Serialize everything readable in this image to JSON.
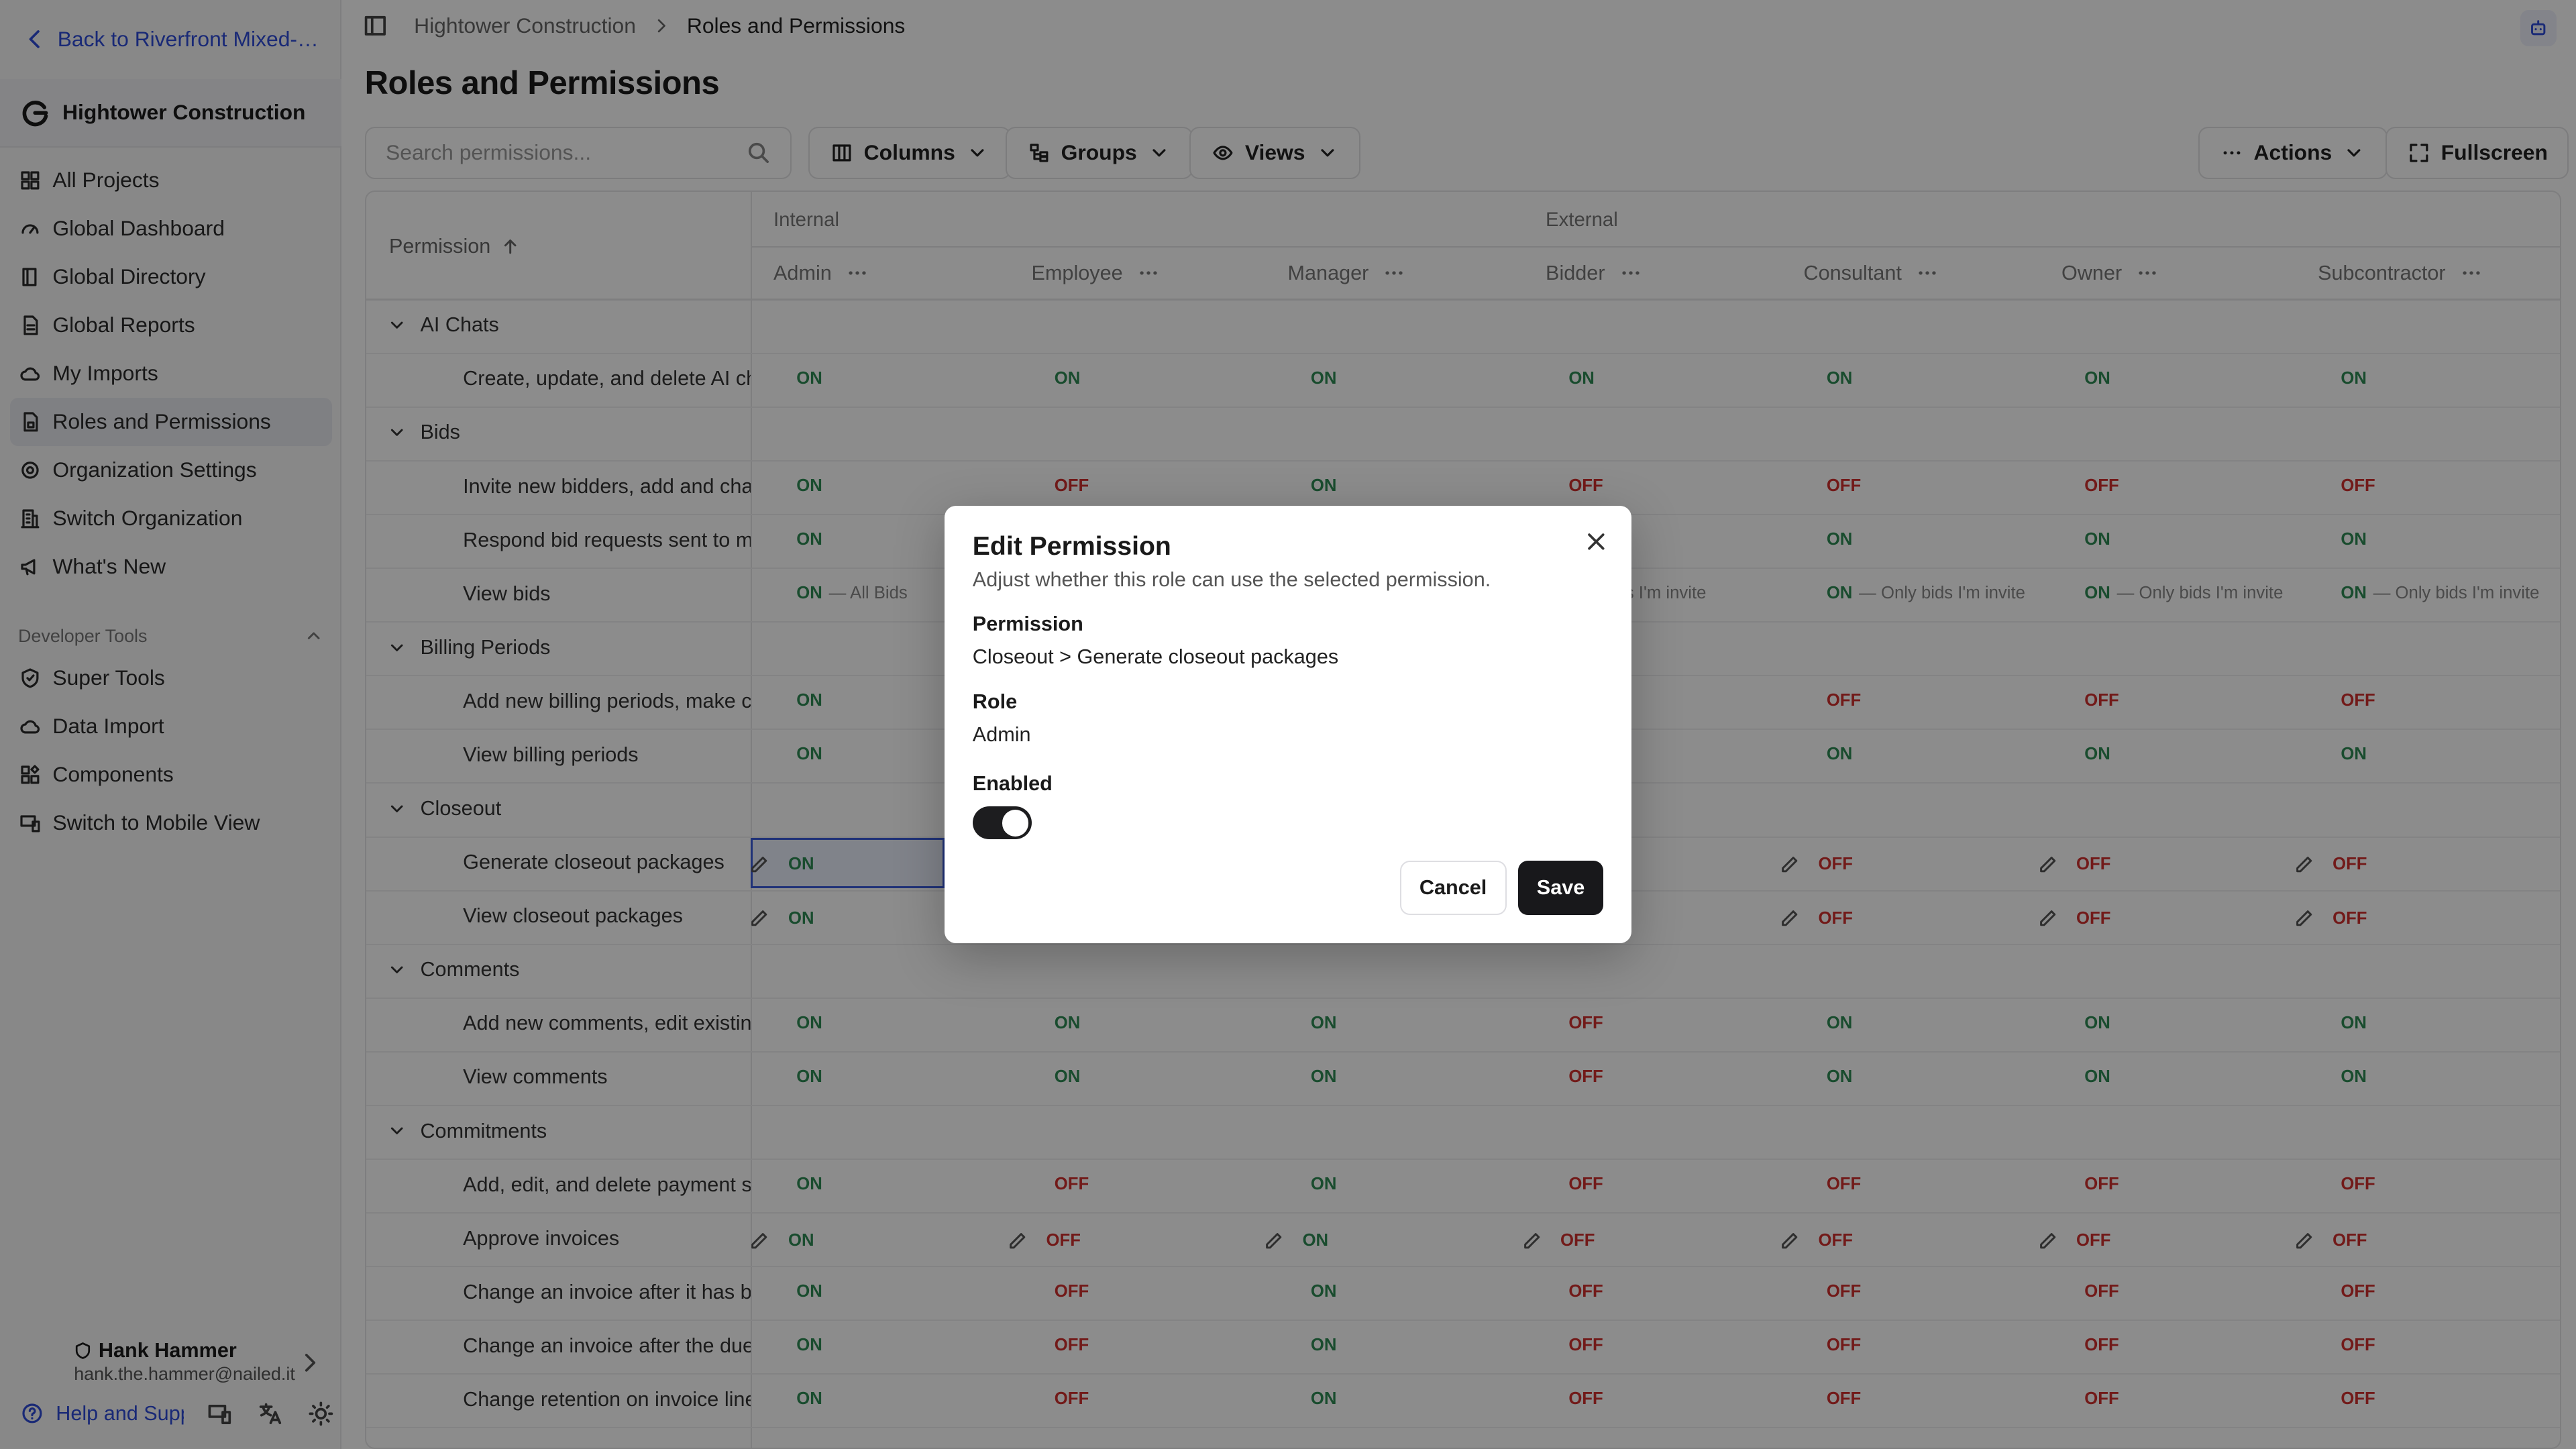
{
  "sidebar": {
    "back_label": "Back to Riverfront Mixed-Use Development",
    "org_name": "Hightower Construction",
    "nav": [
      {
        "label": "All Projects",
        "icon": "grid-icon"
      },
      {
        "label": "Global Dashboard",
        "icon": "gauge-icon"
      },
      {
        "label": "Global Directory",
        "icon": "book-icon"
      },
      {
        "label": "Global Reports",
        "icon": "report-icon"
      },
      {
        "label": "My Imports",
        "icon": "cloud-icon"
      },
      {
        "label": "Roles and Permissions",
        "icon": "lock-file-icon"
      },
      {
        "label": "Organization Settings",
        "icon": "gear-icon"
      },
      {
        "label": "Switch Organization",
        "icon": "building-icon"
      },
      {
        "label": "What's New",
        "icon": "megaphone-icon"
      }
    ],
    "dev_tools_title": "Developer Tools",
    "dev_nav": [
      {
        "label": "Super Tools",
        "icon": "shield-icon"
      },
      {
        "label": "Data Import",
        "icon": "cloud-icon"
      },
      {
        "label": "Components",
        "icon": "components-icon"
      },
      {
        "label": "Switch to Mobile View",
        "icon": "monitor-icon"
      }
    ],
    "user": {
      "name": "Hank Hammer",
      "email": "hank.the.hammer@nailed.it"
    },
    "help_label": "Help and Support"
  },
  "breadcrumb": {
    "org": "Hightower Construction",
    "current": "Roles and Permissions"
  },
  "page_title": "Roles and Permissions",
  "toolbar": {
    "search_placeholder": "Search permissions...",
    "columns": "Columns",
    "groups": "Groups",
    "views": "Views",
    "actions": "Actions",
    "fullscreen": "Fullscreen"
  },
  "table": {
    "permission_header": "Permission",
    "group_internal": "Internal",
    "group_external": "External",
    "roles": [
      "Admin",
      "Employee",
      "Manager",
      "Bidder",
      "Consultant",
      "Owner",
      "Subcontractor"
    ],
    "rows": [
      {
        "type": "group",
        "label": "AI Chats"
      },
      {
        "type": "perm",
        "label": "Create, update, and delete AI chats",
        "cells": [
          [
            "ON",
            ""
          ],
          [
            "ON",
            ""
          ],
          [
            "ON",
            ""
          ],
          [
            "ON",
            ""
          ],
          [
            "ON",
            ""
          ],
          [
            "ON",
            ""
          ],
          [
            "ON",
            ""
          ]
        ]
      },
      {
        "type": "group",
        "label": "Bids"
      },
      {
        "type": "perm",
        "label": "Invite new bidders, add and change bids",
        "cells": [
          [
            "ON",
            ""
          ],
          [
            "OFF",
            ""
          ],
          [
            "ON",
            ""
          ],
          [
            "OFF",
            ""
          ],
          [
            "OFF",
            ""
          ],
          [
            "OFF",
            ""
          ],
          [
            "OFF",
            ""
          ]
        ]
      },
      {
        "type": "perm",
        "label": "Respond bid requests sent to me",
        "cells": [
          [
            "ON",
            ""
          ],
          [
            "",
            ""
          ],
          [
            "",
            ""
          ],
          [
            "",
            ""
          ],
          [
            "ON",
            ""
          ],
          [
            "ON",
            ""
          ],
          [
            "ON",
            ""
          ]
        ]
      },
      {
        "type": "perm",
        "label": "View bids",
        "cells": [
          [
            "ON",
            "— All Bids"
          ],
          [
            "",
            ""
          ],
          [
            "",
            ""
          ],
          [
            "",
            "Only bids I'm invite"
          ],
          [
            "ON",
            "— Only bids I'm invite"
          ],
          [
            "ON",
            "— Only bids I'm invite"
          ],
          [
            "ON",
            "— Only bids I'm invite"
          ]
        ]
      },
      {
        "type": "group",
        "label": "Billing Periods"
      },
      {
        "type": "perm",
        "label": "Add new billing periods, make changes",
        "cells": [
          [
            "ON",
            ""
          ],
          [
            "",
            ""
          ],
          [
            "",
            ""
          ],
          [
            "",
            ""
          ],
          [
            "OFF",
            ""
          ],
          [
            "OFF",
            ""
          ],
          [
            "OFF",
            ""
          ]
        ]
      },
      {
        "type": "perm",
        "label": "View billing periods",
        "cells": [
          [
            "ON",
            ""
          ],
          [
            "",
            ""
          ],
          [
            "",
            ""
          ],
          [
            "",
            ""
          ],
          [
            "ON",
            ""
          ],
          [
            "ON",
            ""
          ],
          [
            "ON",
            ""
          ]
        ]
      },
      {
        "type": "group",
        "label": "Closeout"
      },
      {
        "type": "perm",
        "label": "Generate closeout packages",
        "pen": true,
        "cells": [
          [
            "ON",
            ""
          ],
          [
            "",
            ""
          ],
          [
            "",
            ""
          ],
          [
            "",
            ""
          ],
          [
            "OFF",
            ""
          ],
          [
            "OFF",
            ""
          ],
          [
            "OFF",
            ""
          ]
        ]
      },
      {
        "type": "perm",
        "label": "View closeout packages",
        "pen": true,
        "cells": [
          [
            "ON",
            ""
          ],
          [
            "",
            ""
          ],
          [
            "",
            ""
          ],
          [
            "",
            ""
          ],
          [
            "OFF",
            ""
          ],
          [
            "OFF",
            ""
          ],
          [
            "OFF",
            ""
          ]
        ]
      },
      {
        "type": "group",
        "label": "Comments"
      },
      {
        "type": "perm",
        "label": "Add new comments, edit existing",
        "cells": [
          [
            "ON",
            ""
          ],
          [
            "ON",
            ""
          ],
          [
            "ON",
            ""
          ],
          [
            "OFF",
            ""
          ],
          [
            "ON",
            ""
          ],
          [
            "ON",
            ""
          ],
          [
            "ON",
            ""
          ]
        ]
      },
      {
        "type": "perm",
        "label": "View comments",
        "cells": [
          [
            "ON",
            ""
          ],
          [
            "ON",
            ""
          ],
          [
            "ON",
            ""
          ],
          [
            "OFF",
            ""
          ],
          [
            "ON",
            ""
          ],
          [
            "ON",
            ""
          ],
          [
            "ON",
            ""
          ]
        ]
      },
      {
        "type": "group",
        "label": "Commitments"
      },
      {
        "type": "perm",
        "label": "Add, edit, and delete payment sub",
        "cells": [
          [
            "ON",
            ""
          ],
          [
            "OFF",
            ""
          ],
          [
            "ON",
            ""
          ],
          [
            "OFF",
            ""
          ],
          [
            "OFF",
            ""
          ],
          [
            "OFF",
            ""
          ],
          [
            "OFF",
            ""
          ]
        ]
      },
      {
        "type": "perm",
        "label": "Approve invoices",
        "pen": true,
        "cells": [
          [
            "ON",
            ""
          ],
          [
            "OFF",
            ""
          ],
          [
            "ON",
            ""
          ],
          [
            "OFF",
            ""
          ],
          [
            "OFF",
            ""
          ],
          [
            "OFF",
            ""
          ],
          [
            "OFF",
            ""
          ]
        ]
      },
      {
        "type": "perm",
        "label": "Change an invoice after it has been",
        "cells": [
          [
            "ON",
            ""
          ],
          [
            "OFF",
            ""
          ],
          [
            "ON",
            ""
          ],
          [
            "OFF",
            ""
          ],
          [
            "OFF",
            ""
          ],
          [
            "OFF",
            ""
          ],
          [
            "OFF",
            ""
          ]
        ]
      },
      {
        "type": "perm",
        "label": "Change an invoice after the due d",
        "cells": [
          [
            "ON",
            ""
          ],
          [
            "OFF",
            ""
          ],
          [
            "ON",
            ""
          ],
          [
            "OFF",
            ""
          ],
          [
            "OFF",
            ""
          ],
          [
            "OFF",
            ""
          ],
          [
            "OFF",
            ""
          ]
        ]
      },
      {
        "type": "perm",
        "label": "Change retention on invoice line i",
        "cells": [
          [
            "ON",
            ""
          ],
          [
            "OFF",
            ""
          ],
          [
            "ON",
            ""
          ],
          [
            "OFF",
            ""
          ],
          [
            "OFF",
            ""
          ],
          [
            "OFF",
            ""
          ],
          [
            "OFF",
            ""
          ]
        ]
      }
    ]
  },
  "modal": {
    "title": "Edit Permission",
    "description": "Adjust whether this role can use the selected permission.",
    "permission_label": "Permission",
    "permission_value": "Closeout > Generate closeout packages",
    "role_label": "Role",
    "role_value": "Admin",
    "enabled_label": "Enabled",
    "enabled": true,
    "cancel": "Cancel",
    "save": "Save"
  }
}
